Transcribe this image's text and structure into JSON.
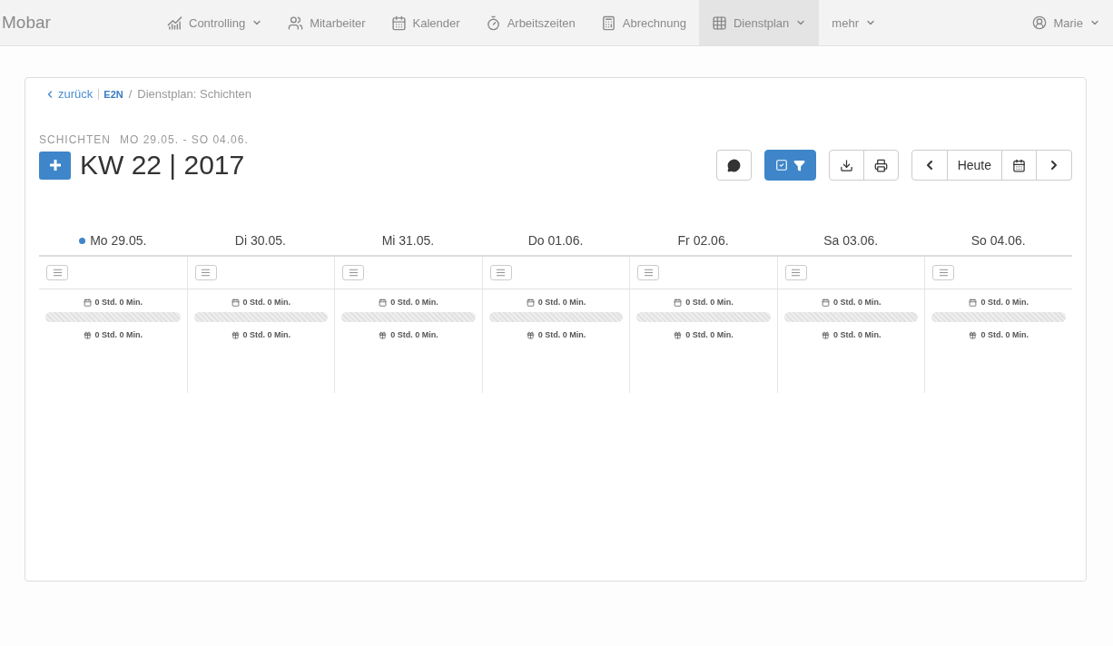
{
  "brand": "Mobar",
  "nav": [
    {
      "label": "Controlling",
      "dropdown": true,
      "selected": false
    },
    {
      "label": "Mitarbeiter",
      "dropdown": false,
      "selected": false
    },
    {
      "label": "Kalender",
      "dropdown": false,
      "selected": false
    },
    {
      "label": "Arbeitszeiten",
      "dropdown": false,
      "selected": false
    },
    {
      "label": "Abrechnung",
      "dropdown": false,
      "selected": false
    },
    {
      "label": "Dienstplan",
      "dropdown": true,
      "selected": true
    },
    {
      "label": "mehr",
      "dropdown": true,
      "selected": false
    }
  ],
  "user": {
    "name": "Marie"
  },
  "breadcrumb": {
    "back": "zurück",
    "logo": "E2N",
    "separator": "/",
    "current": "Dienstplan: Schichten"
  },
  "header": {
    "subtitle": "SCHICHTEN",
    "range": "MO 29.05. - SO 04.06.",
    "title": "KW 22 | 2017"
  },
  "toolbar": {
    "today": "Heute"
  },
  "days": [
    {
      "label": "Mo 29.05.",
      "today": true,
      "planned": "0 Std. 0 Min.",
      "actual": "0 Std. 0 Min."
    },
    {
      "label": "Di 30.05.",
      "today": false,
      "planned": "0 Std. 0 Min.",
      "actual": "0 Std. 0 Min."
    },
    {
      "label": "Mi 31.05.",
      "today": false,
      "planned": "0 Std. 0 Min.",
      "actual": "0 Std. 0 Min."
    },
    {
      "label": "Do 01.06.",
      "today": false,
      "planned": "0 Std. 0 Min.",
      "actual": "0 Std. 0 Min."
    },
    {
      "label": "Fr 02.06.",
      "today": false,
      "planned": "0 Std. 0 Min.",
      "actual": "0 Std. 0 Min."
    },
    {
      "label": "Sa 03.06.",
      "today": false,
      "planned": "0 Std. 0 Min.",
      "actual": "0 Std. 0 Min."
    },
    {
      "label": "So 04.06.",
      "today": false,
      "planned": "0 Std. 0 Min.",
      "actual": "0 Std. 0 Min."
    }
  ]
}
